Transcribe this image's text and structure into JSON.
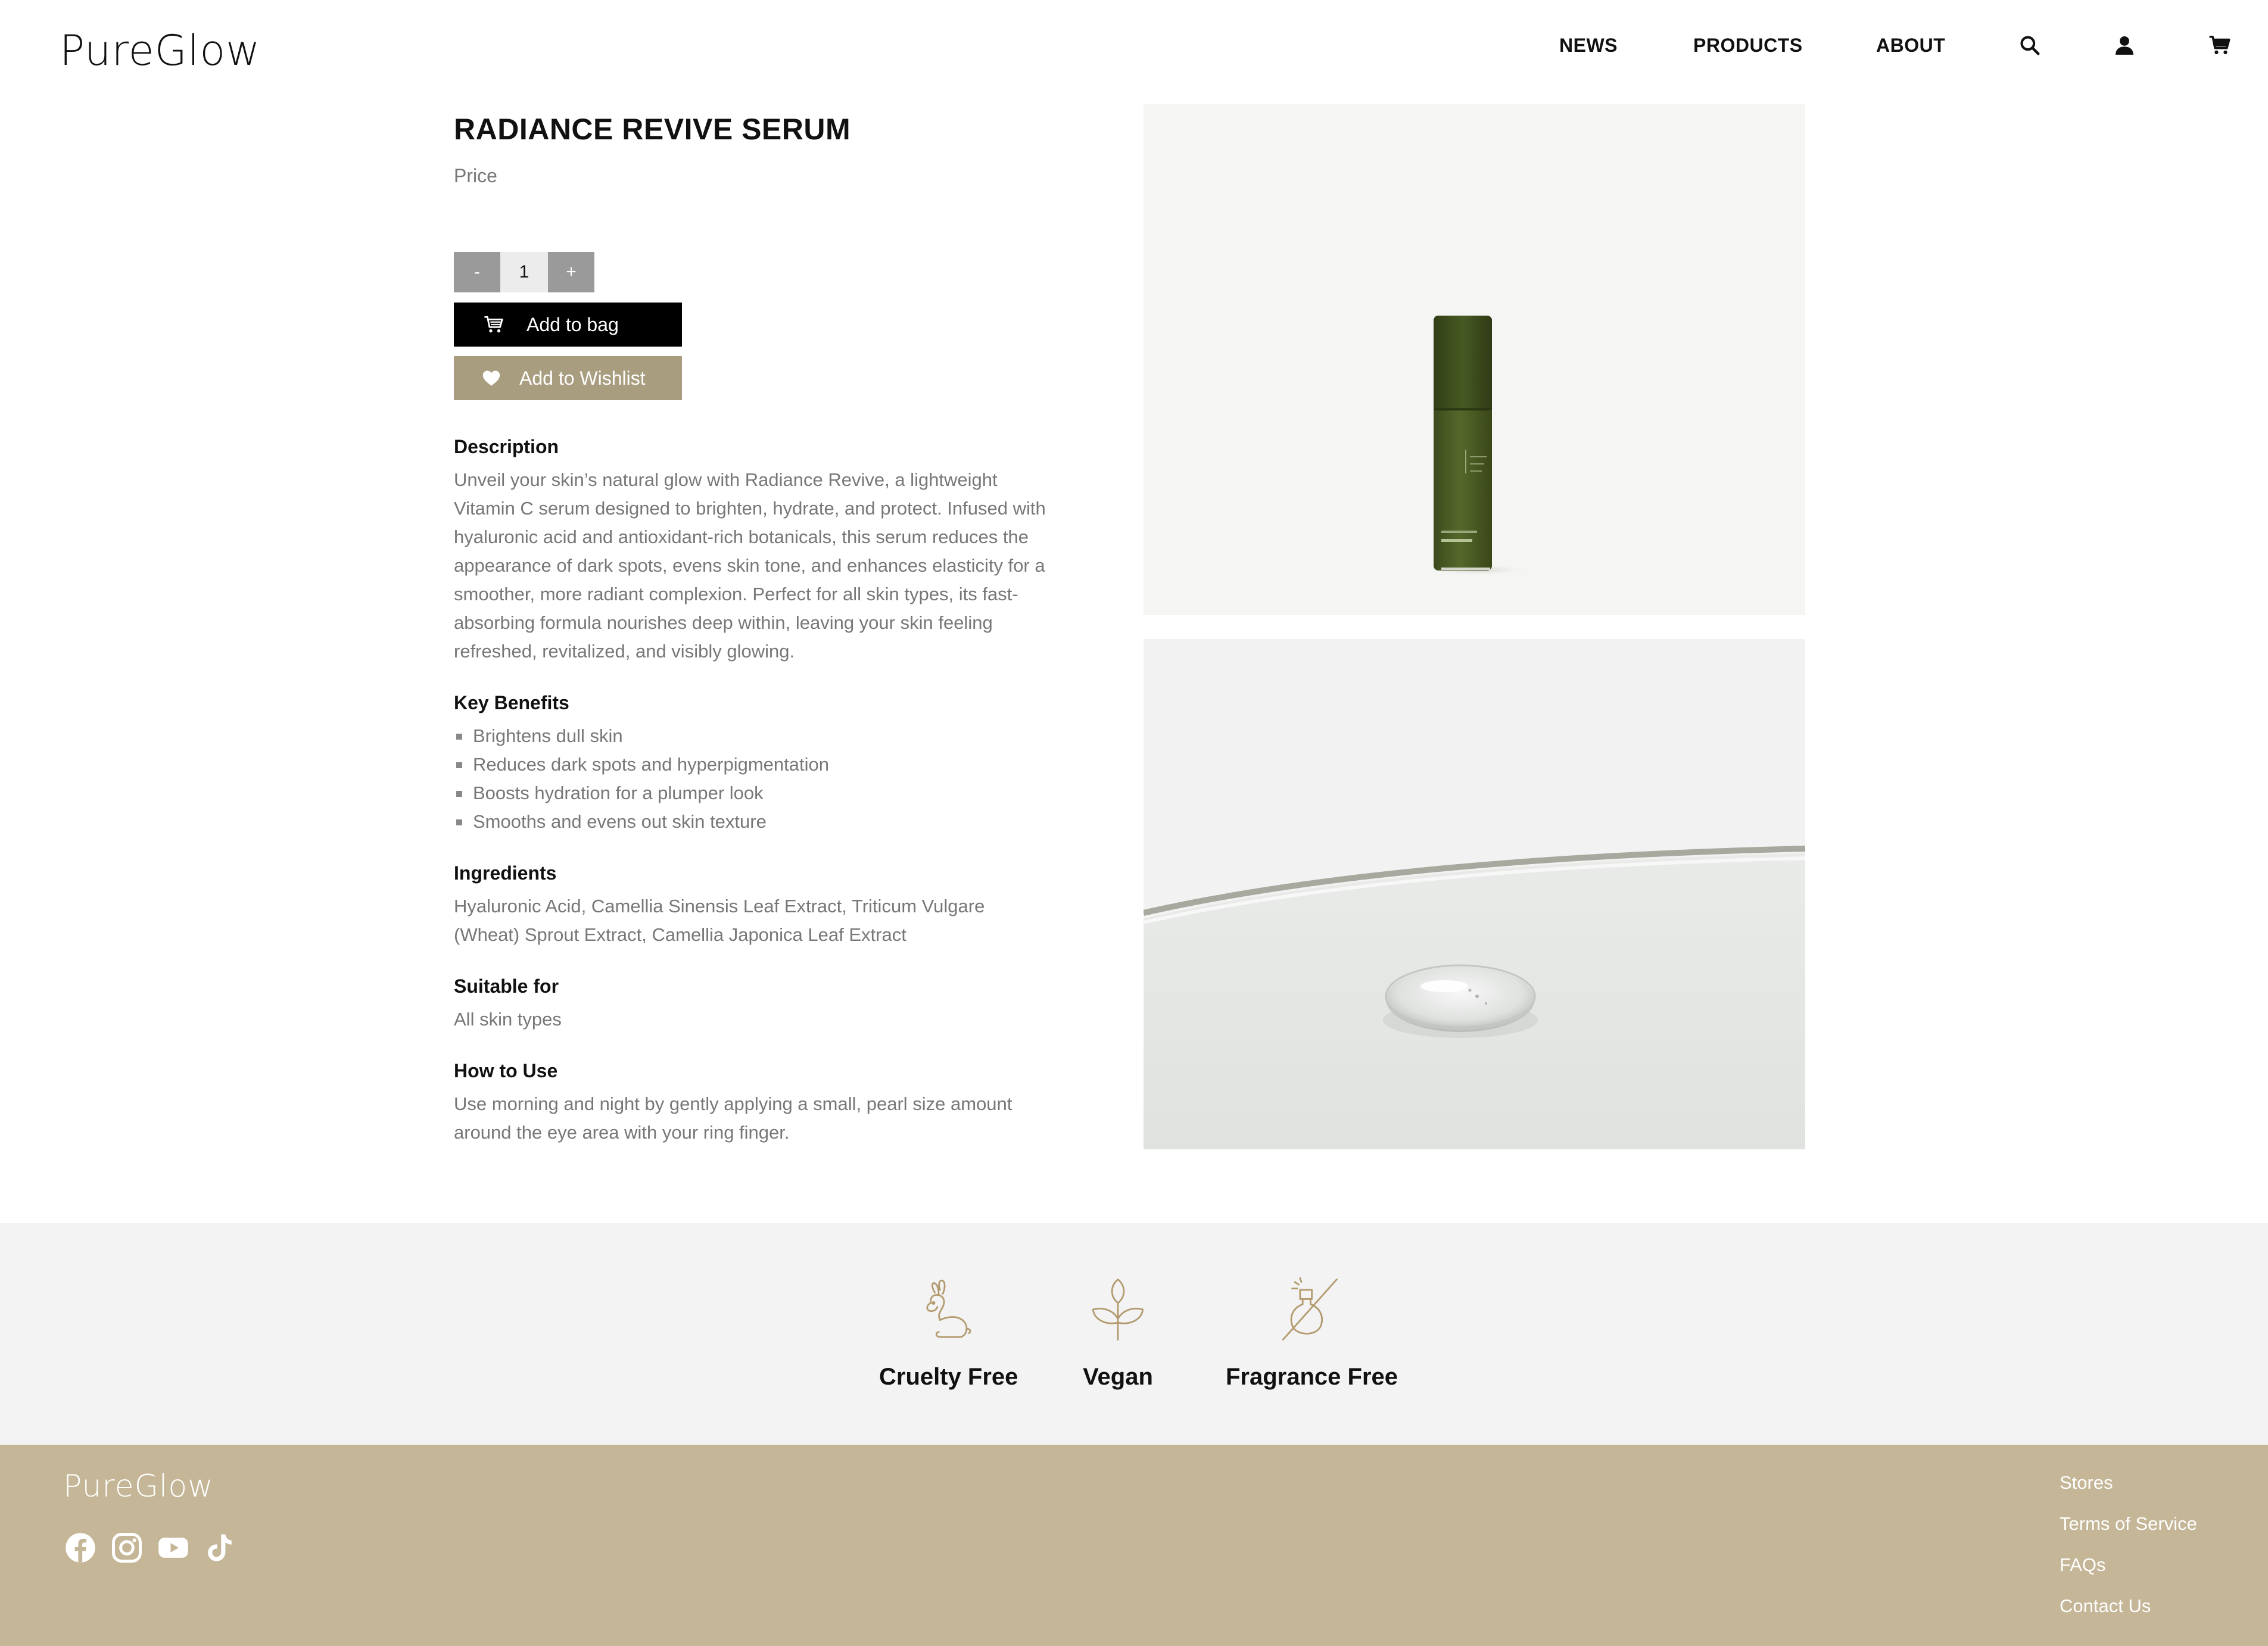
{
  "header": {
    "logo": "PureGlow",
    "nav": [
      "NEWS",
      "PRODUCTS",
      "ABOUT"
    ],
    "icons": [
      "search-icon",
      "user-icon",
      "cart-icon"
    ]
  },
  "product": {
    "title": "RADIANCE REVIVE SERUM",
    "price_label": "Price",
    "quantity": {
      "minus": "-",
      "value": "1",
      "plus": "+"
    },
    "add_to_bag": "Add to bag",
    "add_to_wishlist": "Add to Wishlist",
    "description": {
      "heading": "Description",
      "text": "Unveil your skin’s natural glow with Radiance Revive, a lightweight Vitamin C serum designed to brighten, hydrate, and protect. Infused with hyaluronic acid and antioxidant-rich botanicals, this serum reduces the appearance of dark spots, evens skin tone, and enhances elasticity for a smoother, more radiant complexion. Perfect for all skin types, its fast-absorbing formula nourishes deep within, leaving your skin feeling refreshed, revitalized, and visibly glowing."
    },
    "benefits": {
      "heading": "Key Benefits",
      "items": [
        "Brightens dull skin",
        "Reduces dark spots and hyperpigmentation",
        "Boosts hydration for a plumper look",
        "Smooths and evens out skin texture"
      ]
    },
    "ingredients": {
      "heading": "Ingredients",
      "text": "Hyaluronic Acid, Camellia Sinensis Leaf Extract, Triticum Vulgare (Wheat) Sprout Extract, Camellia Japonica Leaf Extract"
    },
    "suitable": {
      "heading": "Suitable for",
      "text": "All skin types"
    },
    "howto": {
      "heading": "How to Use",
      "text": "Use morning and night by gently applying a small, pearl size amount around the eye area with your ring finger."
    }
  },
  "badges": [
    {
      "label": "Cruelty Free",
      "icon": "rabbit-icon"
    },
    {
      "label": "Vegan",
      "icon": "leaf-icon"
    },
    {
      "label": "Fragrance Free",
      "icon": "no-fragrance-icon"
    }
  ],
  "footer": {
    "logo": "PureGlow",
    "social": [
      "facebook-icon",
      "instagram-icon",
      "youtube-icon",
      "tiktok-icon"
    ],
    "links": [
      "Stores",
      "Terms of Service",
      "FAQs",
      "Contact Us"
    ]
  },
  "colors": {
    "black": "#000000",
    "wishlist_button": "#a89d7f",
    "footer_bg": "#c4b696",
    "badge_icon": "#b39a6e",
    "badges_bg": "#f2f3f2",
    "body_text": "#777777",
    "qty_button": "#9a9a9a"
  }
}
